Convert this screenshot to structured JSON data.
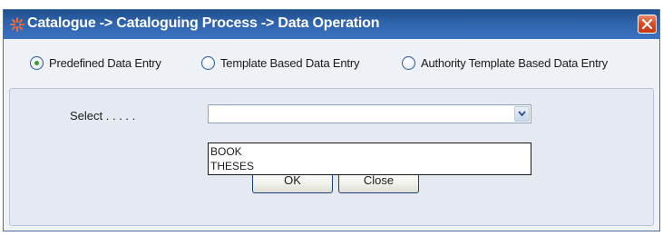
{
  "window": {
    "title": "Catalogue -> Cataloguing Process -> Data Operation",
    "close_label": "Close window"
  },
  "entry_mode": {
    "options": [
      {
        "label": "Predefined Data Entry",
        "selected": true
      },
      {
        "label": "Template Based Data Entry",
        "selected": false
      },
      {
        "label": "Authority Template Based Data Entry",
        "selected": false
      }
    ]
  },
  "form": {
    "select_label": "Select . . . . .",
    "select_value": "",
    "dropdown_options": [
      "BOOK",
      "THESES"
    ]
  },
  "buttons": {
    "ok_label": "OK",
    "close_label": "Close"
  },
  "colors": {
    "titlebar": "#2f64ad",
    "close_button": "#d54b22",
    "selected_radio": "#3c9a35"
  },
  "icons": {
    "app": "asterisk-icon",
    "close": "close-icon",
    "dropdown": "chevron-down-icon"
  }
}
